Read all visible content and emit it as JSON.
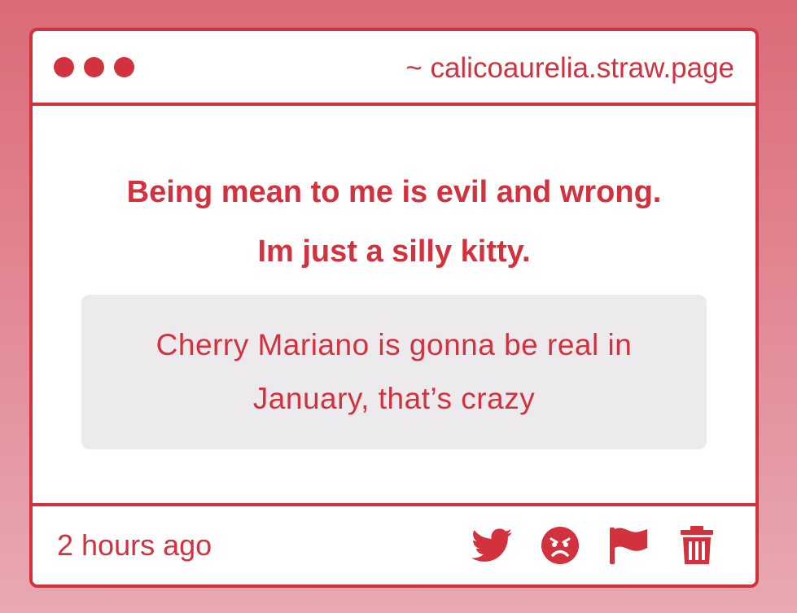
{
  "window": {
    "url": "~ calicoaurelia.straw.page"
  },
  "content": {
    "question_line1": "Being mean to me is evil and wrong.",
    "question_line2": "Im just a silly kitty.",
    "answer": "Cherry Mariano is gonna be real in January, that’s crazy"
  },
  "footer": {
    "timestamp": "2 hours ago",
    "actions": [
      "twitter-icon",
      "angry-face-icon",
      "flag-icon",
      "trash-icon"
    ]
  },
  "colors": {
    "accent": "#d2323d",
    "answer_bg": "#edeaed",
    "page_bg_top": "#db6a78",
    "page_bg_bottom": "#e9a9b2"
  }
}
